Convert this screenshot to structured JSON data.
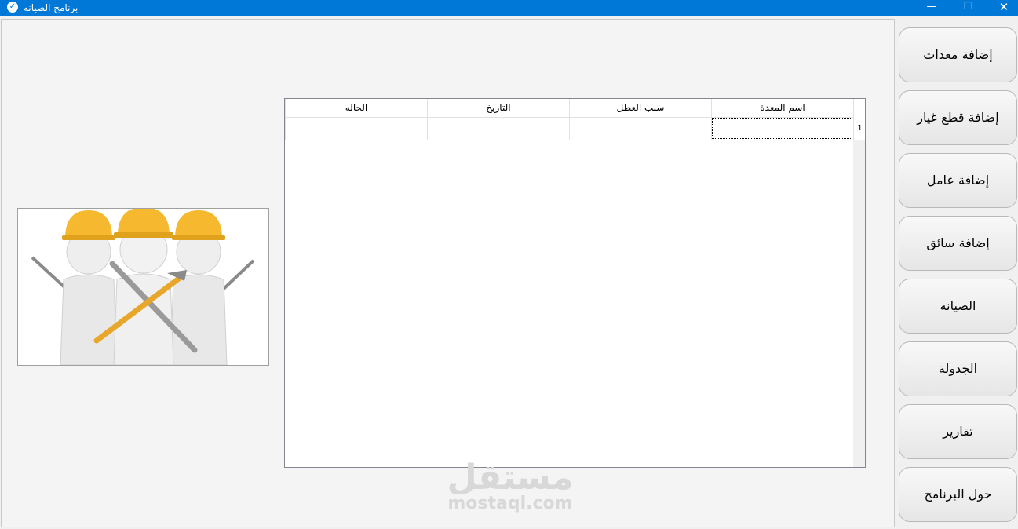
{
  "window": {
    "title": "برنامج الصيانه",
    "icon": "check-icon",
    "controls": {
      "minimize": "—",
      "maximize": "☐",
      "close": "✕"
    }
  },
  "grid": {
    "columns": [
      "اسم المعدة",
      "سبب العطل",
      "التاريخ",
      "الحاله"
    ],
    "rows": [
      {
        "row_number": "1",
        "cells": [
          "",
          "",
          "",
          ""
        ]
      }
    ]
  },
  "sidebar": {
    "buttons": [
      {
        "label": "إضافة معدات"
      },
      {
        "label": "إضافة قطع غيار"
      },
      {
        "label": "إضافة عامل"
      },
      {
        "label": "إضافة سائق"
      },
      {
        "label": "الصيانه"
      },
      {
        "label": "الجدولة"
      },
      {
        "label": "تقارير"
      },
      {
        "label": "حول البرنامج"
      }
    ]
  },
  "watermark": {
    "arabic": "مستقل",
    "english": "mostaql.com"
  },
  "colors": {
    "titlebar": "#0078d7",
    "helmet": "#f5b82e",
    "figure": "#ececec"
  }
}
